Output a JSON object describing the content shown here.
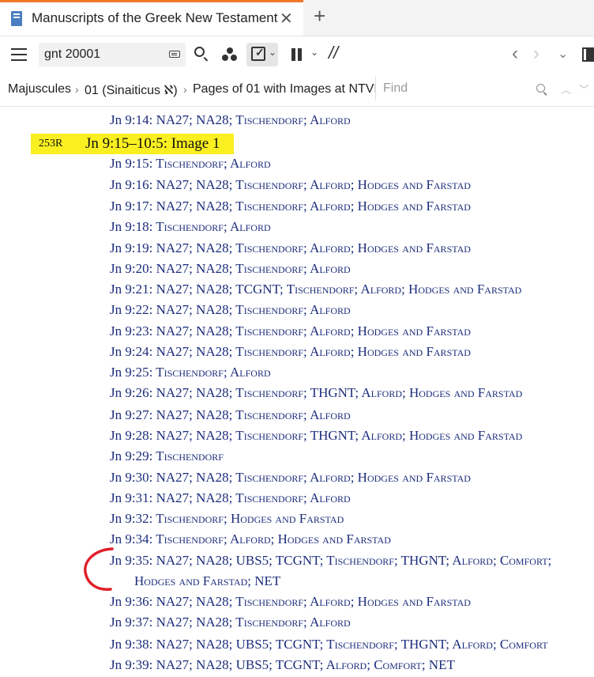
{
  "tab": {
    "title": "Manuscripts of the Greek New Testament",
    "close_glyph": "✕",
    "add_glyph": "+"
  },
  "toolbar": {
    "search_value": "gnt 20001",
    "slash_glyph": "//",
    "chevron_glyph": "⌄"
  },
  "nav": {
    "back_glyph": "‹",
    "forward_glyph": "›",
    "menu_glyph": "⌄"
  },
  "breadcrumb": {
    "items": [
      "Majuscules",
      "01 (Sinaiticus ℵ)",
      "Pages of 01 with Images at NTVMR"
    ],
    "separator": "›"
  },
  "find": {
    "placeholder": "Find",
    "up_glyph": "︿",
    "down_glyph": "﹀"
  },
  "content": {
    "top_line": "Jn 9:14: NA27; NA28; Tischendorf; Alford",
    "page_number": "253R",
    "image_title": "Jn 9:15–10:5: Image 1",
    "entries": [
      "Jn 9:15: Tischendorf; Alford",
      "Jn 9:16: NA27; NA28; Tischendorf; Alford; Hodges and Farstad",
      "Jn 9:17: NA27; NA28; Tischendorf; Alford; Hodges and Farstad",
      "Jn 9:18: Tischendorf; Alford",
      "Jn 9:19: NA27; NA28; Tischendorf; Alford; Hodges and Farstad",
      "Jn 9:20: NA27; NA28; Tischendorf; Alford",
      "Jn 9:21: NA27; NA28; TCGNT; Tischendorf; Alford; Hodges and Farstad",
      "Jn 9:22: NA27; NA28; Tischendorf; Alford",
      "Jn 9:23: NA27; NA28; Tischendorf; Alford; Hodges and Farstad",
      "Jn 9:24: NA27; NA28; Tischendorf; Alford; Hodges and Farstad",
      "Jn 9:25: Tischendorf; Alford",
      "Jn 9:26: NA27; NA28; Tischendorf; THGNT; Alford; Hodges and Farstad",
      "Jn 9:27: NA27; NA28; Tischendorf; Alford",
      "Jn 9:28: NA27; NA28; Tischendorf; THGNT; Alford; Hodges and Farstad",
      "Jn 9:29: Tischendorf",
      "Jn 9:30: NA27; NA28; Tischendorf; Alford; Hodges and Farstad",
      "Jn 9:31: NA27; NA28; Tischendorf; Alford",
      "Jn 9:32: Tischendorf; Hodges and Farstad",
      "Jn 9:34: Tischendorf; Alford; Hodges and Farstad",
      "Jn 9:35: NA27; NA28; UBS5; TCGNT; Tischendorf; THGNT; Alford; Comfort;",
      "Hodges and Farstad; NET",
      "Jn 9:36: NA27; NA28; Tischendorf; Alford; Hodges and Farstad",
      "Jn 9:37: NA27; NA28; Tischendorf; Alford",
      "Jn 9:38: NA27; NA28; UBS5; TCGNT; Tischendorf; THGNT; Alford; Comfort",
      "Jn 9:39: NA27; NA28; UBS5; TCGNT; Alford; Comfort; NET"
    ]
  },
  "colors": {
    "accent_tab": "#f07a2a",
    "link": "#1c2d7c",
    "highlight": "#f9ef21",
    "annotation": "#e0202a"
  }
}
